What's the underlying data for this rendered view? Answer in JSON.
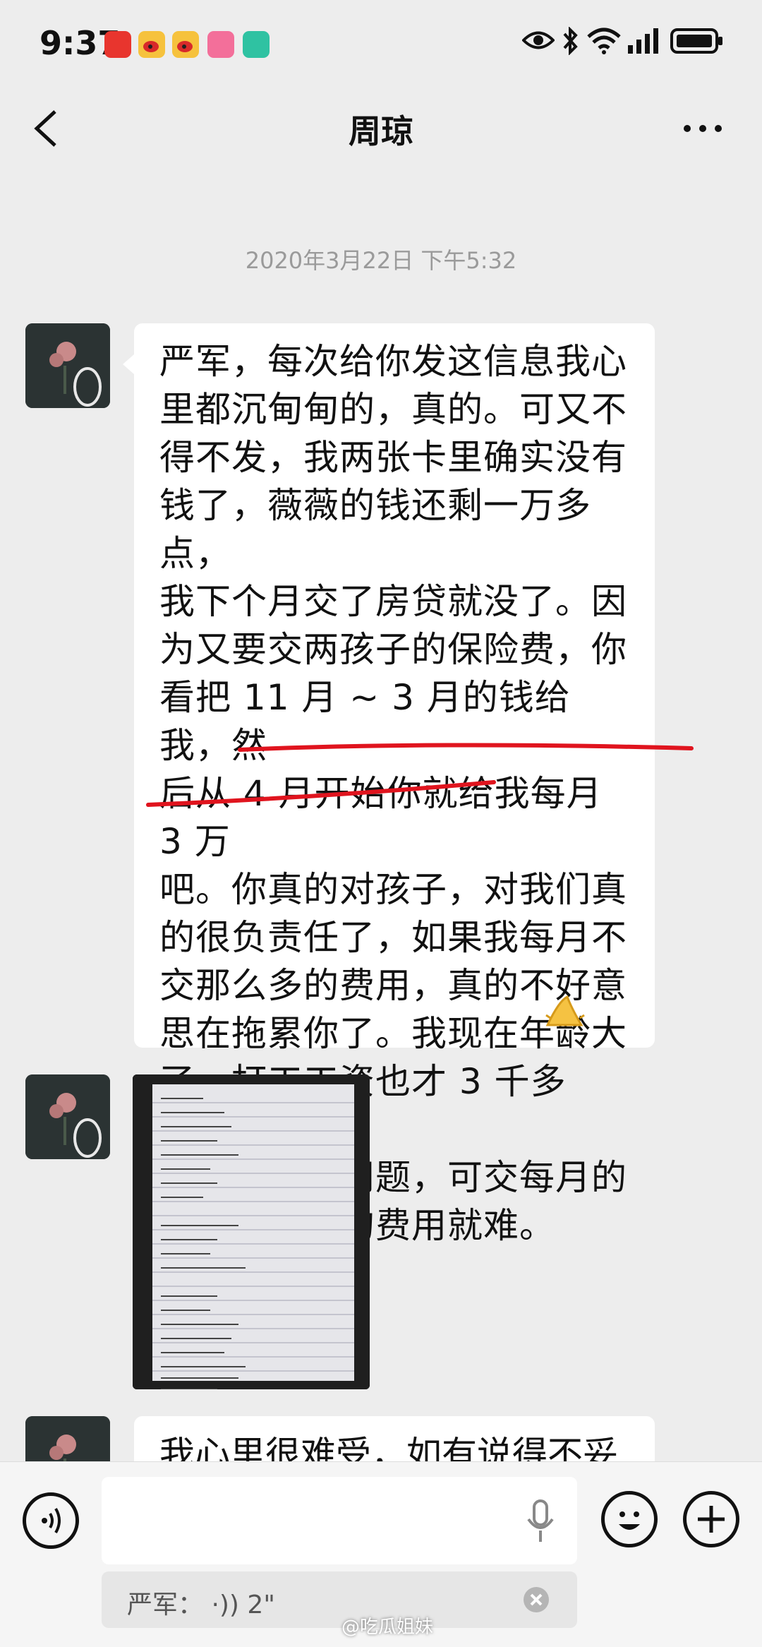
{
  "status_bar": {
    "time": "9:37",
    "app_icons": [
      "huawei-icon",
      "weibo-icon",
      "weibo-icon",
      "bilibili-icon",
      "fingerprint-app-icon"
    ],
    "right_icons": [
      "eye-icon",
      "bluetooth-icon",
      "wifi-icon",
      "signal-icon",
      "battery-icon"
    ]
  },
  "header": {
    "title": "周琼"
  },
  "chat": {
    "timestamp": "2020年3月22日 下午5:32",
    "message1": "严军，每次给你发这信息我心\n里都沉甸甸的，真的。可又不\n得不发，我两张卡里确实没有\n钱了，薇薇的钱还剩一万多点，\n我下个月交了房贷就没了。因\n为又要交两孩子的保险费，你\n看把 11 月 ~ 3 月的钱给我，然\n后从 4 月开始你就给我每月 3 万\n吧。你真的对孩子，对我们真\n的很负责任了，如果我每月不\n交那么多的费用，真的不好意\n思在拖累你了。我现在年龄大\n了，打工工资也才 3 千多点，自\n己的生活没问题，可交每月的\n房贷及其他的费用就难。",
    "message1_emoji": "praying-hands-icon",
    "message3": "我心里很难受，如有说得不妥"
  },
  "input_bar": {
    "quote_text": "严军：  ·)) 2\"",
    "watermark": "@吃瓜姐妹"
  },
  "colors": {
    "background": "#ededed",
    "bubble": "#ffffff",
    "underline": "#e0141e"
  }
}
